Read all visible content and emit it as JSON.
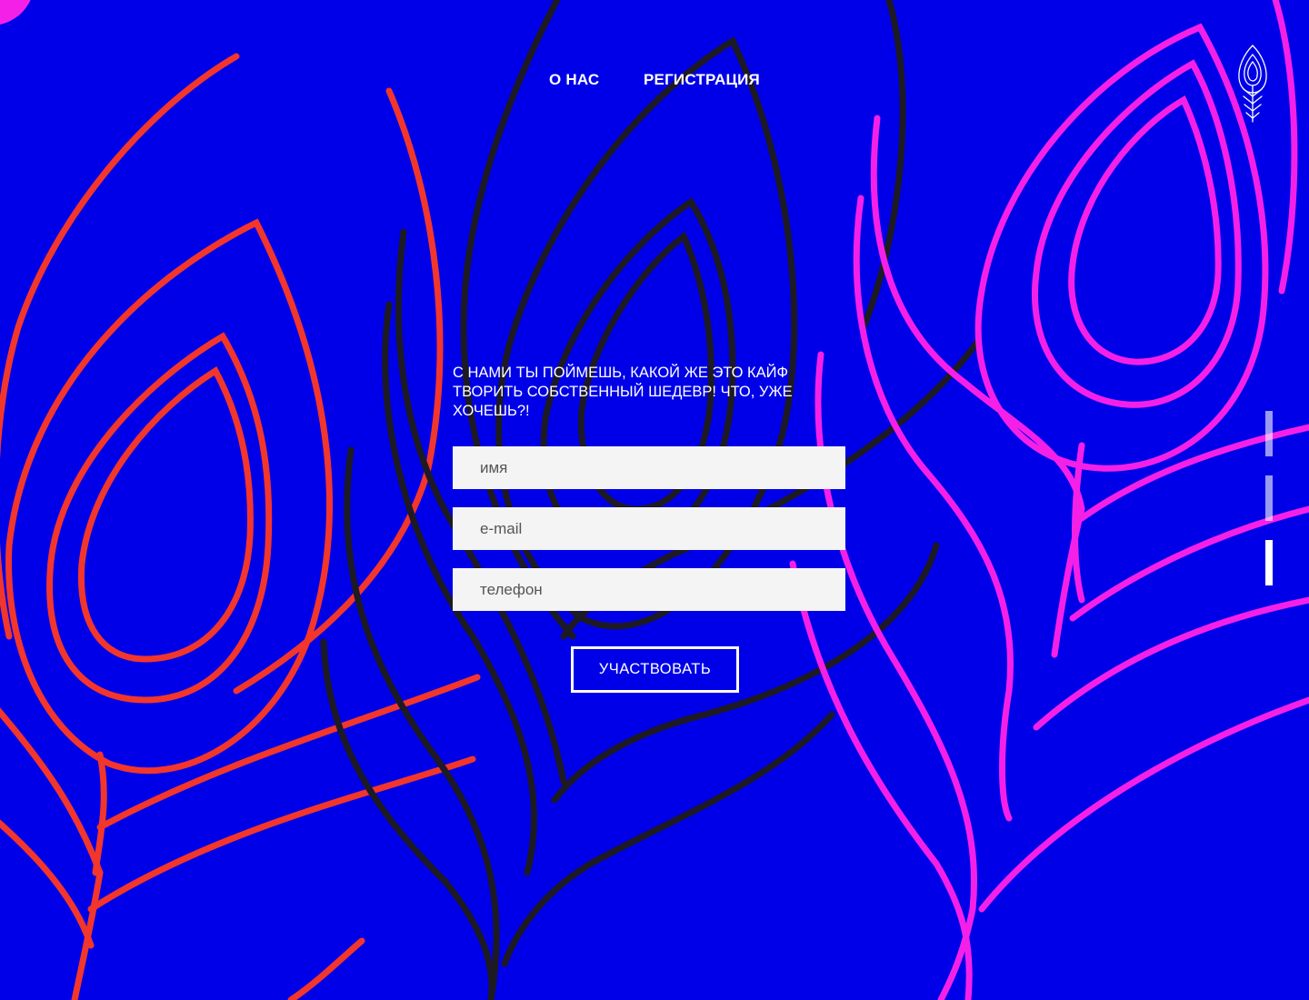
{
  "nav": {
    "about_label": "О НАС",
    "register_label": "РЕГИСТРАЦИЯ"
  },
  "logo": {
    "icon": "peacock-feather-icon"
  },
  "form": {
    "headline": "С НАМИ ТЫ ПОЙМЕШЬ, КАКОЙ ЖЕ ЭТО КАЙФ ТВОРИТЬ СОБСТВЕННЫЙ ШЕДЕВР! ЧТО, УЖЕ ХОЧЕШЬ?!",
    "name_placeholder": "имя",
    "email_placeholder": "e-mail",
    "phone_placeholder": "телефон",
    "submit_label": "УЧАСТВОВАТЬ"
  },
  "pager": {
    "count": 3,
    "active_index": 2
  },
  "colors": {
    "background": "#0000e8",
    "feather_red": "#f2362b",
    "feather_black": "#1d1a24",
    "feather_magenta": "#f520e8",
    "input_bg": "#f4f4f4",
    "text": "#ffffff"
  }
}
